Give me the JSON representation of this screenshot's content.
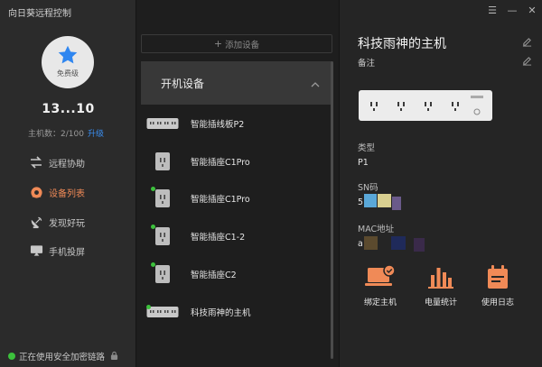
{
  "app": {
    "title": "向日葵远程控制"
  },
  "user": {
    "level": "免费级",
    "name": "13...10",
    "host_count": "主机数：2/100",
    "upgrade_label": "升级"
  },
  "nav": {
    "remote": "远程协助",
    "devices": "设备列表",
    "discover": "发现好玩",
    "screen": "手机投屏"
  },
  "status": {
    "secure": "正在使用安全加密链路"
  },
  "device_list": {
    "add_label": "添加设备",
    "group_name": "开机设备",
    "devices": [
      {
        "name": "智能插线板P2",
        "icon": "power-strip-icon",
        "online": false
      },
      {
        "name": "智能插座C1Pro",
        "icon": "smart-plug-icon",
        "online": false
      },
      {
        "name": "智能插座C1Pro",
        "icon": "smart-plug-icon",
        "online": true
      },
      {
        "name": "智能插座C1-2",
        "icon": "smart-plug-icon",
        "online": true
      },
      {
        "name": "智能插座C2",
        "icon": "smart-plug-icon",
        "online": true
      },
      {
        "name": "科技雨神的主机",
        "icon": "power-strip-icon",
        "online": true
      }
    ]
  },
  "detail": {
    "title": "科技雨神的主机",
    "note_label": "备注",
    "type_label": "类型",
    "type_value": "P1",
    "sn_label": "SN码",
    "sn_value": "5",
    "mac_label": "MAC地址",
    "mac_value": "a",
    "actions": {
      "bind": "绑定主机",
      "power": "电量统计",
      "log": "使用日志"
    }
  },
  "colors": {
    "accent_orange": "#f08a57",
    "link_blue": "#3a8ef0",
    "online_green": "#3cc13c",
    "star_blue": "#2f86f0"
  }
}
